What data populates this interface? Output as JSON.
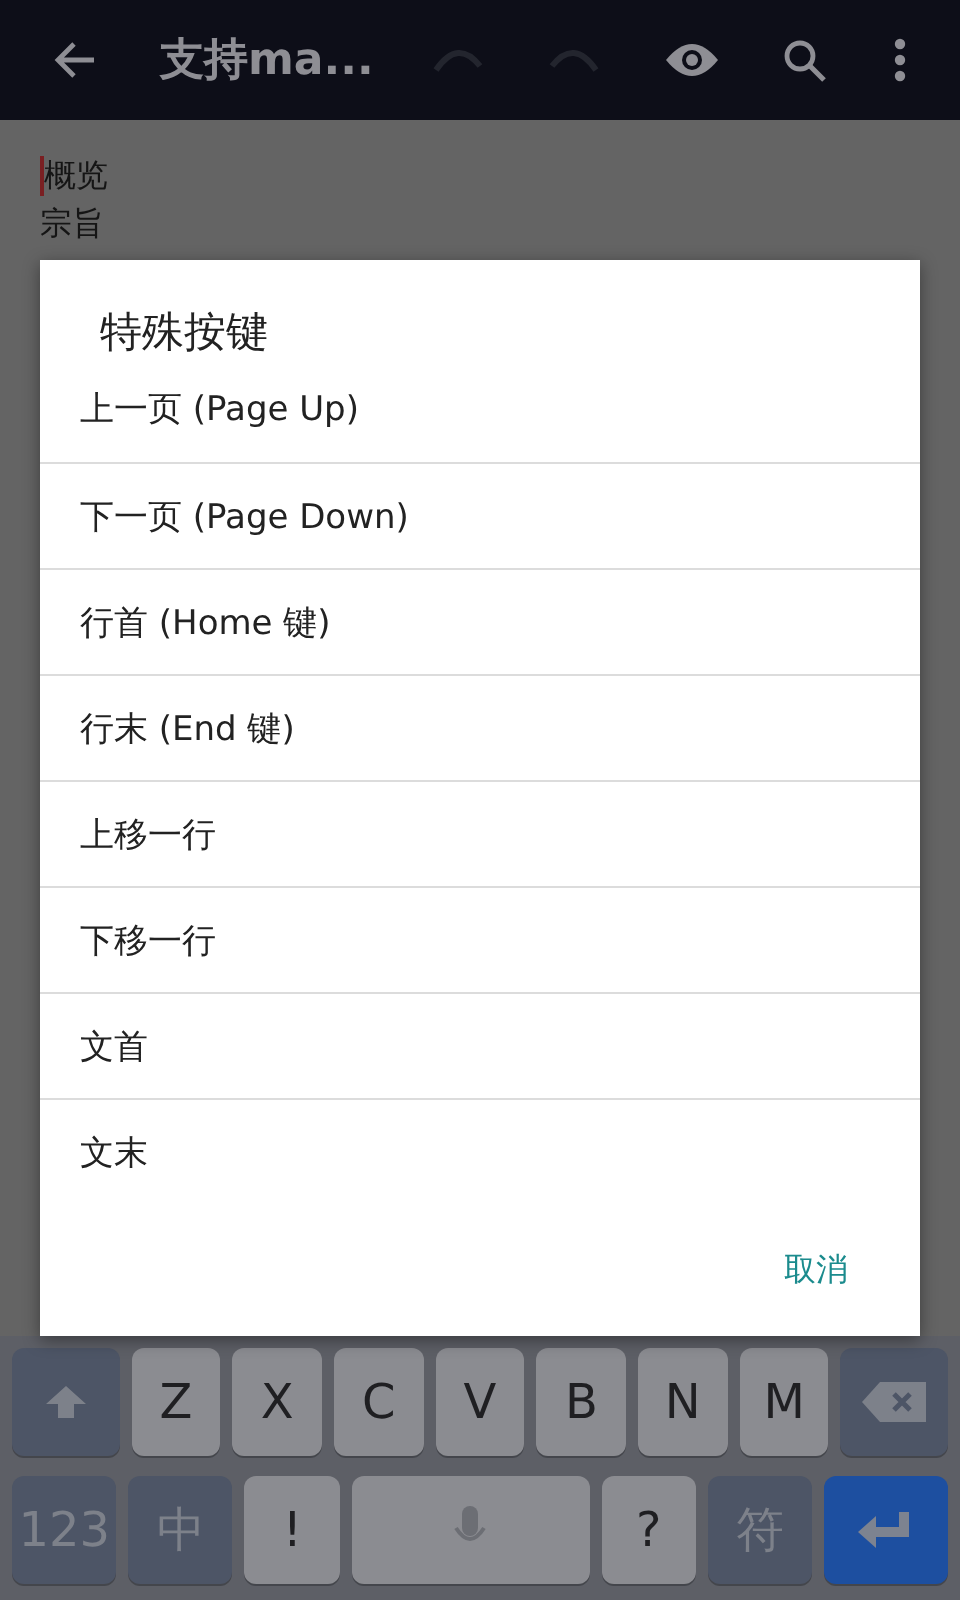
{
  "app_bar": {
    "title": "支持ma...",
    "undo_enabled": false,
    "redo_enabled": false
  },
  "editor": {
    "lines": [
      "概览",
      "宗旨"
    ]
  },
  "dialog": {
    "title": "特殊按键",
    "items": [
      "上一页 (Page Up)",
      "下一页 (Page Down)",
      "行首 (Home 键)",
      "行末 (End 键)",
      "上移一行",
      "下移一行",
      "文首",
      "文末"
    ],
    "cancel": "取消"
  },
  "keyboard": {
    "rows": [
      [
        {
          "kind": "shift"
        },
        {
          "kind": "letter",
          "label": "Z"
        },
        {
          "kind": "letter",
          "label": "X"
        },
        {
          "kind": "letter",
          "label": "C"
        },
        {
          "kind": "letter",
          "label": "V"
        },
        {
          "kind": "letter",
          "label": "B"
        },
        {
          "kind": "letter",
          "label": "N"
        },
        {
          "kind": "letter",
          "label": "M"
        },
        {
          "kind": "backspace"
        }
      ],
      [
        {
          "kind": "function",
          "label": "123"
        },
        {
          "kind": "function",
          "label": "中"
        },
        {
          "kind": "letter",
          "label": "!"
        },
        {
          "kind": "space"
        },
        {
          "kind": "letter",
          "label": "?"
        },
        {
          "kind": "function",
          "label": "符"
        },
        {
          "kind": "enter"
        }
      ]
    ]
  }
}
